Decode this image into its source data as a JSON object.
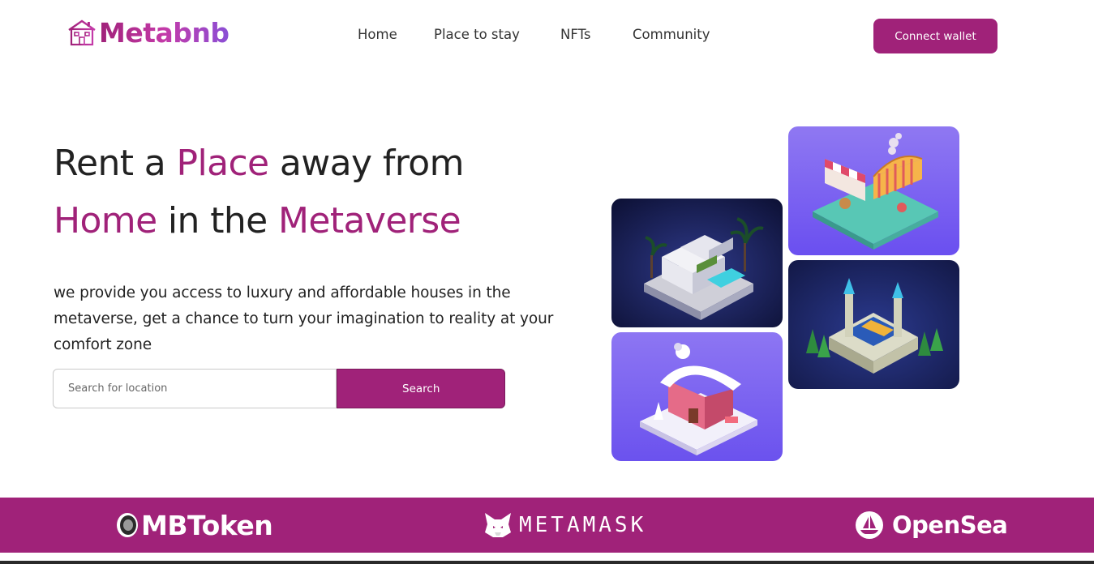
{
  "brand": {
    "name": "Metabnb",
    "icon": "house-icon"
  },
  "nav": {
    "links": [
      {
        "label": "Home"
      },
      {
        "label": "Place to stay"
      },
      {
        "label": "NFTs"
      },
      {
        "label": "Community"
      }
    ],
    "cta": "Connect wallet"
  },
  "hero": {
    "title_part1": "Rent a ",
    "title_accent1": "Place",
    "title_part2": " away from ",
    "title_accent2": "Home",
    "title_part3": " in the ",
    "title_accent3": "Metaverse",
    "description": "we provide you access to luxury and affordable houses in the metaverse, get a chance to turn your imagination to reality at your comfort zone",
    "search_placeholder": "Search for location",
    "search_button": "Search"
  },
  "gallery": {
    "images": [
      "villa-image",
      "market-stall-image",
      "castle-image",
      "snow-house-image"
    ]
  },
  "partners": [
    {
      "name": "MBToken",
      "icon": "mbtoken-icon"
    },
    {
      "name": "METAMASK",
      "icon": "fox-icon"
    },
    {
      "name": "OpenSea",
      "icon": "boat-icon"
    }
  ],
  "colors": {
    "accent": "#a02279",
    "text": "#222222",
    "card_purple": "#8b6cf0",
    "card_navy": "#1e2457"
  }
}
